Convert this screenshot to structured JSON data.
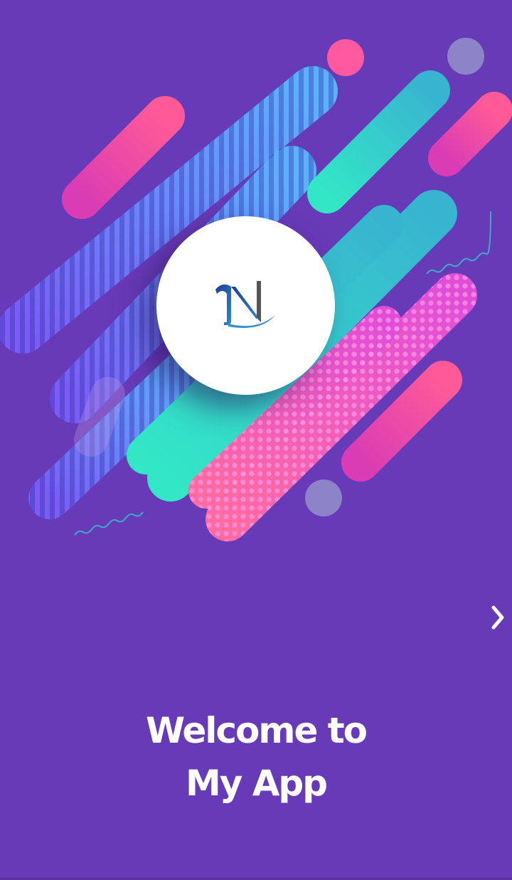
{
  "screen": {
    "background_color": "#673ab7"
  },
  "logo": {
    "letter": "N",
    "icon": "app-logo-n"
  },
  "navigation": {
    "next_icon": "chevron-right-icon"
  },
  "welcome": {
    "line1": "Welcome to",
    "line2": "My App"
  },
  "colors": {
    "pink": "#ff4fa0",
    "teal": "#30d8c8",
    "blue_stripe": "#6a8bff",
    "magenta_dots": "#e64ed0",
    "lavender": "#8c83c8"
  }
}
